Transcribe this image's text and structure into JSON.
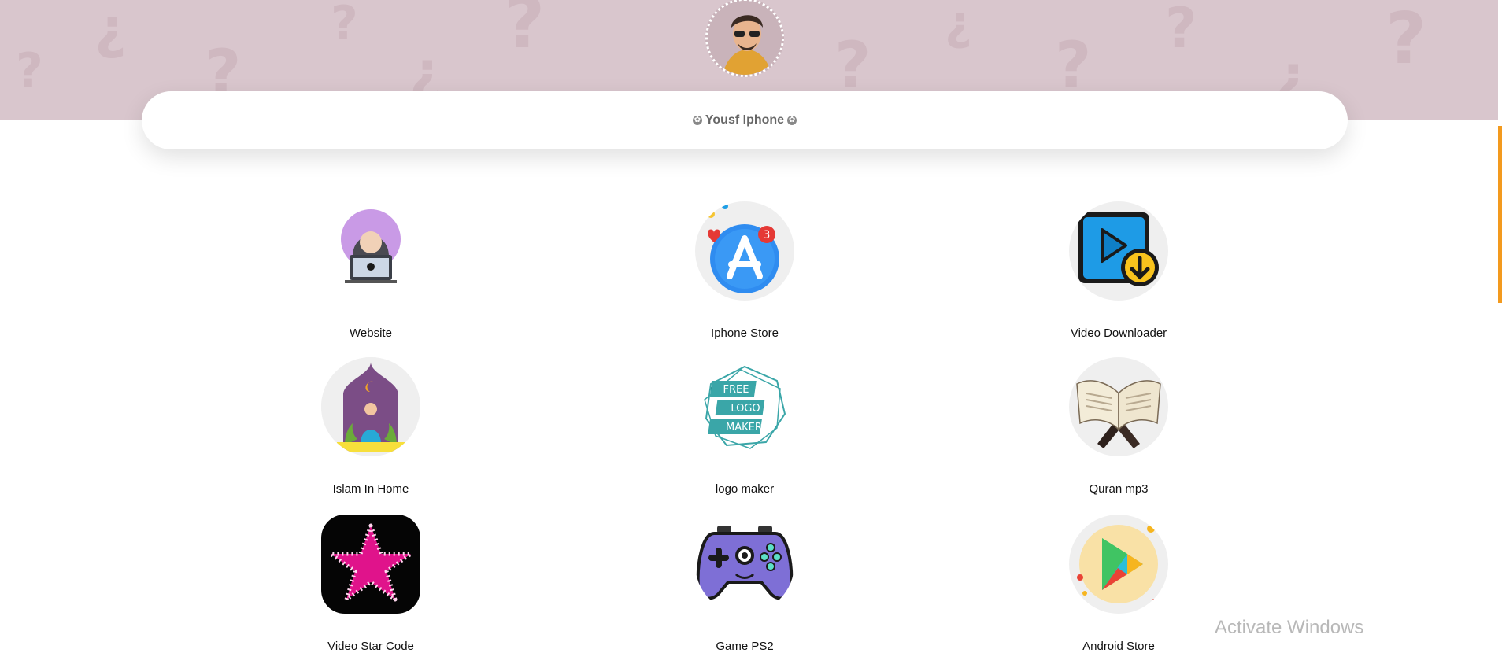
{
  "profile": {
    "name_line": "Yousf Iphone"
  },
  "links": [
    {
      "label": "Website",
      "icon": "hacker-laptop-icon"
    },
    {
      "label": "Iphone Store",
      "icon": "app-store-icon",
      "badge": "3"
    },
    {
      "label": "Video Downloader",
      "icon": "video-download-icon"
    },
    {
      "label": "Islam In Home",
      "icon": "mosque-prayer-icon"
    },
    {
      "label": "logo maker",
      "icon": "logo-maker-icon",
      "lines": [
        "FREE",
        "LOGO",
        "MAKER"
      ]
    },
    {
      "label": "Quran mp3",
      "icon": "quran-book-icon"
    },
    {
      "label": "Video Star Code",
      "icon": "video-star-icon"
    },
    {
      "label": "Game PS2",
      "icon": "gamepad-icon"
    },
    {
      "label": "Android Store",
      "icon": "google-play-icon"
    }
  ],
  "system": {
    "watermark": "Activate Windows"
  },
  "colors": {
    "banner": "#d9c6cd",
    "accent": "#f39a1e"
  }
}
